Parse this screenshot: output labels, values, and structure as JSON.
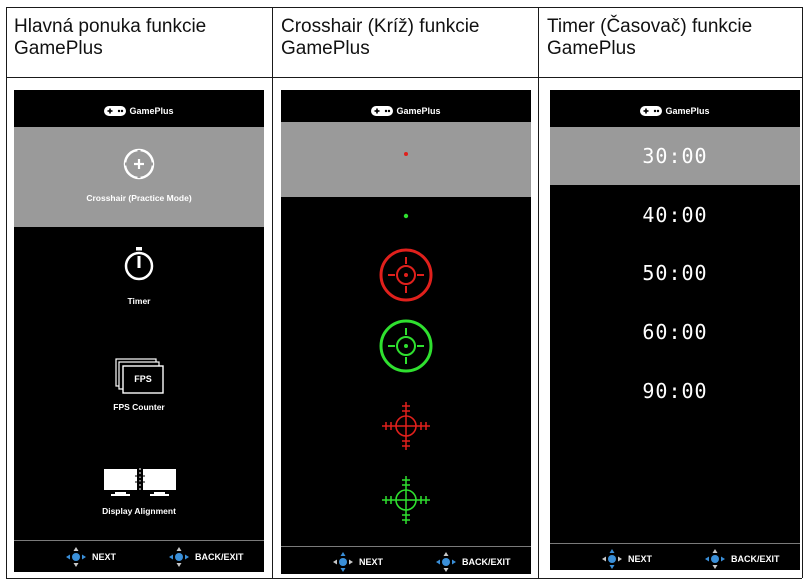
{
  "headers": {
    "col1": "Hlavná ponuka funkcie GamePlus",
    "col2": "Crosshair (Kríž) funkcie GamePlus",
    "col3": "Timer (Časovač) funkcie GamePlus"
  },
  "brand": "GamePlus",
  "main_menu": {
    "crosshair": "Crosshair (Practice Mode)",
    "timer": "Timer",
    "fps_icon_text": "FPS",
    "fps": "FPS Counter",
    "display_alignment": "Display Alignment"
  },
  "timer_values": [
    "30:00",
    "40:00",
    "50:00",
    "60:00",
    "90:00"
  ],
  "footer": {
    "next": "NEXT",
    "back_exit": "BACK/EXIT"
  },
  "colors": {
    "selected": "#9a9a9a",
    "red": "#e0201c",
    "green": "#2fe02f",
    "nav_blue": "#3a8fd8"
  }
}
